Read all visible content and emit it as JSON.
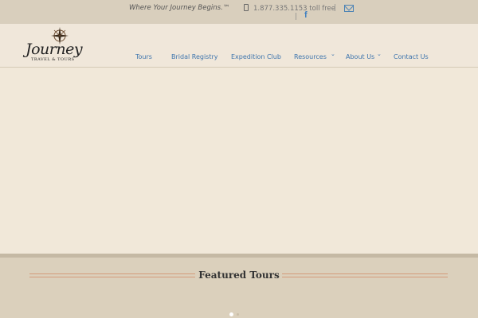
{
  "topbar": {
    "tagline": "Where Your Journey Begins.™",
    "phone": "1.877.335.1153 toll free",
    "separator": "|",
    "icons": [
      "phone-icon",
      "mail-icon",
      "facebook-icon"
    ],
    "facebook_glyph": "f"
  },
  "logo": {
    "word": "Journey",
    "subtitle": "TRAVEL & TOURS"
  },
  "nav": {
    "items": [
      {
        "label": "Tours"
      },
      {
        "label": "Bridal Registry"
      },
      {
        "label": "Expedition Club"
      },
      {
        "label": "Resources"
      },
      {
        "label": "About Us"
      },
      {
        "label": "Contact Us"
      }
    ],
    "dropdown_glyph": "⌄"
  },
  "featured": {
    "title": "Featured Tours"
  },
  "slider": {
    "dot_count": 2,
    "active_index": 0
  },
  "colors": {
    "link": "#3d74ad",
    "accent_rule": "#d49a7a",
    "hero_bg": "#f1e8d9",
    "topbar_bg": "#d9cfbd"
  }
}
